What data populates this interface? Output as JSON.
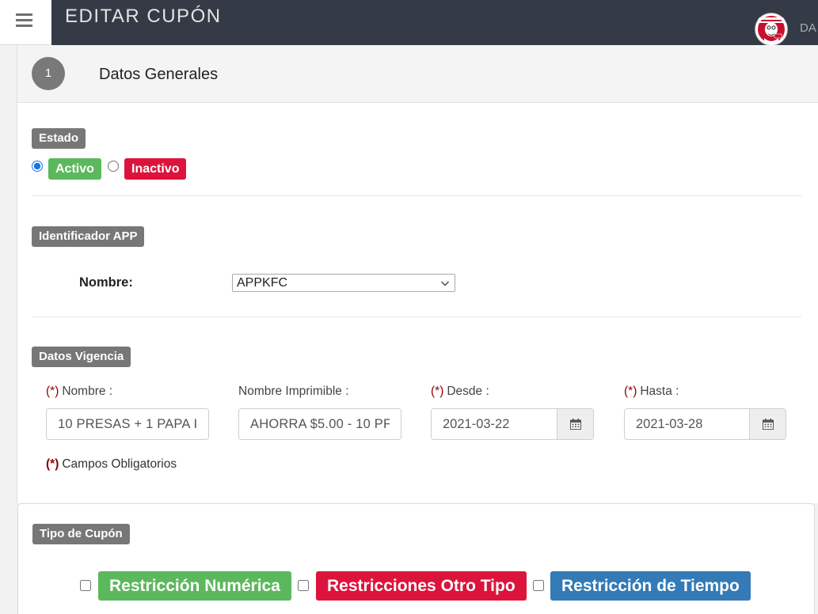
{
  "header": {
    "title": "EDITAR CUPÓN",
    "user_label": "DA",
    "menu_icon": "hamburger-icon",
    "avatar_icon": "kfc-logo-icon"
  },
  "general": {
    "step_number": "1",
    "title": "Datos Generales",
    "estado": {
      "label": "Estado",
      "options": [
        {
          "label": "Activo",
          "checked": true,
          "color": "#5cb85c"
        },
        {
          "label": "Inactivo",
          "checked": false,
          "color": "#dc143c"
        }
      ]
    },
    "identificador": {
      "label": "Identificador APP",
      "nombre_label": "Nombre:",
      "selected": "APPKFC",
      "select_icon": "chevron-down-icon"
    },
    "vigencia": {
      "label": "Datos Vigencia",
      "required_mark": "(*)",
      "fields": [
        {
          "label": "Nombre :",
          "required": true,
          "value": "10 PRESAS + 1 PAPA I"
        },
        {
          "label": "Nombre Imprimible :",
          "required": false,
          "value": "AHORRA $5.00 - 10 PF"
        },
        {
          "label": "Desde :",
          "required": true,
          "value": "2021-03-22",
          "icon": "calendar-icon"
        },
        {
          "label": "Hasta :",
          "required": true,
          "value": "2021-03-28",
          "icon": "calendar-icon"
        }
      ],
      "footnote": "Campos Obligatorios"
    }
  },
  "tipo_cupon": {
    "label": "Tipo de Cupón",
    "options": [
      {
        "label": "Restricción Numérica",
        "checked": false,
        "color": "#5cb85c"
      },
      {
        "label": "Restricciones Otro Tipo",
        "checked": false,
        "color": "#dc143c"
      },
      {
        "label": "Restricción de Tiempo",
        "checked": false,
        "color": "#337ab7"
      }
    ]
  },
  "colors": {
    "topbar": "#343a46",
    "label_badge": "#777777",
    "required": "#8b0000"
  }
}
